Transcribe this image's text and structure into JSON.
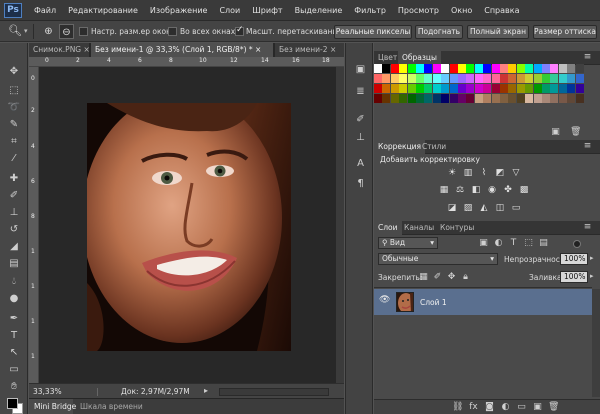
{
  "app": {
    "logo": "Ps"
  },
  "menu": [
    "Файл",
    "Редактирование",
    "Изображение",
    "Слои",
    "Шрифт",
    "Выделение",
    "Фильтр",
    "Просмотр",
    "Окно",
    "Справка"
  ],
  "options": {
    "resize_windows": "Настр. разм.ер окон",
    "all_windows": "Во всех окнах",
    "scrubby_zoom": "Масшт. перетаскиванием",
    "actual_pixels": "Реальные пикселы",
    "fit_screen": "Подогнать",
    "fill_screen": "Полный экран",
    "print_size": "Размер оттиска"
  },
  "tabs": [
    "Снимок.PNG",
    "Без имени-1 @ 33,3% (Слой 1, RGB/8*) *",
    "Без имени-2"
  ],
  "ruler": {
    "top": [
      "0",
      "2",
      "4",
      "6",
      "8",
      "10",
      "12",
      "14",
      "16",
      "18"
    ],
    "left": [
      "0",
      "2",
      "4",
      "6",
      "8",
      "1",
      "1",
      "1",
      "1"
    ]
  },
  "status": {
    "zoom": "33,33%",
    "doc": "Док: 2,97М/2,97М"
  },
  "bottom_tabs": [
    "Mini Bridge",
    "Шкала времени"
  ],
  "panels": {
    "swatches_tabs": [
      "Цвет",
      "Образцы"
    ],
    "adjust_tabs": [
      "Коррекция",
      "Стили"
    ],
    "adjust_title": "Добавить корректировку",
    "layers_tabs": [
      "Слои",
      "Каналы",
      "Контуры"
    ],
    "kind": "Вид",
    "blend": "Обычные",
    "opacity_label": "Непрозрачность:",
    "opacity_value": "100%",
    "lock_label": "Закрепить:",
    "fill_label": "Заливка:",
    "fill_value": "100%",
    "layer_name": "Слой 1"
  },
  "colors": {
    "accent_layer": "#5a6f8f",
    "ps_blue": "#8cb8f0"
  },
  "swatch_rows": [
    [
      "#ffffff",
      "#000000",
      "#ff0000",
      "#ffff00",
      "#00ff00",
      "#00ffff",
      "#0000ff",
      "#ff00ff",
      "#ffffff",
      "#ff0000",
      "#ffff00",
      "#00ff00",
      "#00ffff",
      "#0000ff",
      "#ff00ff",
      "#ff8080",
      "#ffcc00",
      "#88ff00",
      "#00ffaa",
      "#00aaff",
      "#8080ff",
      "#ff80ff",
      "#c0c0c0",
      "#808080",
      "#404040"
    ],
    [
      "#ff6666",
      "#ff9966",
      "#ffcc66",
      "#ffff66",
      "#ccff66",
      "#66ff66",
      "#66ffcc",
      "#66ffff",
      "#66ccff",
      "#6699ff",
      "#9966ff",
      "#cc66ff",
      "#ff66ff",
      "#ff66cc",
      "#ff6699",
      "#cc3333",
      "#cc6633",
      "#cc9933",
      "#cccc33",
      "#99cc33",
      "#33cc33",
      "#33cc99",
      "#33cccc",
      "#3399cc",
      "#3366cc"
    ],
    [
      "#cc0000",
      "#cc6600",
      "#cc9900",
      "#cccc00",
      "#66cc00",
      "#00cc00",
      "#00cc66",
      "#00cccc",
      "#0099cc",
      "#0066cc",
      "#6600cc",
      "#9900cc",
      "#cc00cc",
      "#cc0099",
      "#990033",
      "#993300",
      "#996600",
      "#999900",
      "#669900",
      "#009900",
      "#009966",
      "#009999",
      "#006699",
      "#003399",
      "#330099"
    ],
    [
      "#660000",
      "#663300",
      "#666600",
      "#336600",
      "#006600",
      "#006633",
      "#006666",
      "#003366",
      "#000066",
      "#330066",
      "#660066",
      "#660033",
      "#c8a080",
      "#b08060",
      "#987050",
      "#806040",
      "#685030",
      "#504020",
      "#d8b8a0",
      "#c0a090",
      "#a88878",
      "#907060",
      "#785848",
      "#604838",
      "#483020"
    ]
  ]
}
